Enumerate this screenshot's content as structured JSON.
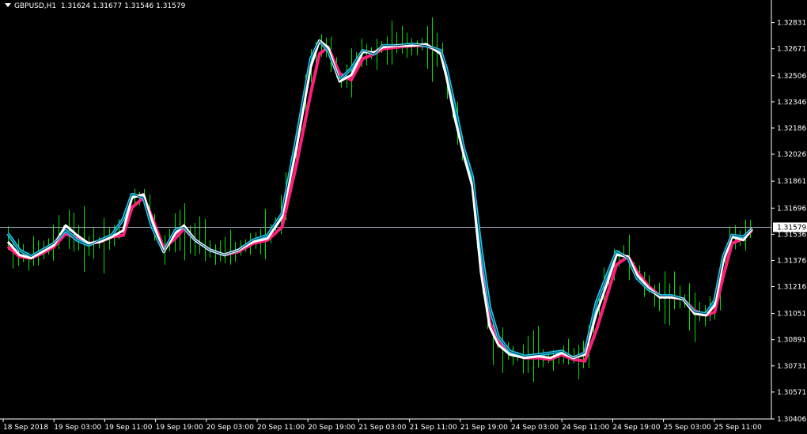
{
  "header": {
    "symbol_tf": "GBPUSD,H1",
    "ohlc": "1.31624 1.31677 1.31546 1.31579"
  },
  "colors": {
    "background": "#000000",
    "candle_wick": "#00e000",
    "ma_fast": "#1ec8f0",
    "ma_mid": "#ffffff",
    "ma_slow": "#ff1f7a",
    "price_line": "#aab4c8",
    "axis": "#ffffff"
  },
  "chart_data": {
    "type": "line",
    "symbol": "GBPUSD",
    "timeframe": "H1",
    "current_price": 1.31579,
    "y_ticks": [
      "1.32831",
      "1.32671",
      "1.32506",
      "1.32346",
      "1.32186",
      "1.32026",
      "1.31861",
      "1.31696",
      "1.31536",
      "1.31376",
      "1.31216",
      "1.31051",
      "1.30891",
      "1.30731",
      "1.30571",
      "1.30406"
    ],
    "x_ticks": [
      "18 Sep 2018",
      "19 Sep 03:00",
      "19 Sep 11:00",
      "19 Sep 19:00",
      "20 Sep 03:00",
      "20 Sep 11:00",
      "20 Sep 19:00",
      "21 Sep 03:00",
      "21 Sep 11:00",
      "21 Sep 19:00",
      "24 Sep 03:00",
      "24 Sep 11:00",
      "24 Sep 19:00",
      "25 Sep 03:00",
      "25 Sep 11:00"
    ],
    "ylim": [
      1.30406,
      1.32921
    ],
    "series": [
      {
        "name": "",
        "color": "#1ec8f0",
        "values": [
          [
            0,
            1.3154
          ],
          [
            0.8,
            1.3144
          ],
          [
            1.6,
            1.314
          ],
          [
            2.4,
            1.3144
          ],
          [
            3.2,
            1.3148
          ],
          [
            4,
            1.3156
          ],
          [
            4.8,
            1.315
          ],
          [
            5.6,
            1.3147
          ],
          [
            6.4,
            1.315
          ],
          [
            7.2,
            1.3153
          ],
          [
            8,
            1.3163
          ],
          [
            8.6,
            1.3178
          ],
          [
            9.4,
            1.3176
          ],
          [
            10,
            1.3158
          ],
          [
            10.8,
            1.3143
          ],
          [
            11.6,
            1.3156
          ],
          [
            12.2,
            1.3158
          ],
          [
            13,
            1.315
          ],
          [
            14,
            1.3144
          ],
          [
            15,
            1.3141
          ],
          [
            16,
            1.3144
          ],
          [
            17,
            1.315
          ],
          [
            18,
            1.3153
          ],
          [
            19,
            1.3166
          ],
          [
            20,
            1.3212
          ],
          [
            21,
            1.3261
          ],
          [
            21.6,
            1.3272
          ],
          [
            22.2,
            1.3266
          ],
          [
            23,
            1.3248
          ],
          [
            23.8,
            1.3255
          ],
          [
            24.6,
            1.3266
          ],
          [
            25.4,
            1.3264
          ],
          [
            26,
            1.3269
          ],
          [
            27,
            1.3269
          ],
          [
            28,
            1.327
          ],
          [
            29,
            1.3269
          ],
          [
            30,
            1.3266
          ],
          [
            30.4,
            1.3255
          ],
          [
            31,
            1.3231
          ],
          [
            31.6,
            1.3206
          ],
          [
            32.2,
            1.3189
          ],
          [
            32.8,
            1.3145
          ],
          [
            33.4,
            1.3109
          ],
          [
            34,
            1.3091
          ],
          [
            34.8,
            1.3082
          ],
          [
            35.8,
            1.3079
          ],
          [
            36.8,
            1.308
          ],
          [
            37.6,
            1.3081
          ],
          [
            38.4,
            1.3082
          ],
          [
            39.2,
            1.3078
          ],
          [
            40,
            1.3081
          ],
          [
            40.8,
            1.3112
          ],
          [
            41.6,
            1.313
          ],
          [
            42.2,
            1.3143
          ],
          [
            43,
            1.3139
          ],
          [
            43.6,
            1.3127
          ],
          [
            44.4,
            1.312
          ],
          [
            45.2,
            1.3116
          ],
          [
            46,
            1.3116
          ],
          [
            46.8,
            1.3114
          ],
          [
            47.6,
            1.3106
          ],
          [
            48.4,
            1.3105
          ],
          [
            49,
            1.3113
          ],
          [
            49.6,
            1.314
          ],
          [
            50.2,
            1.3153
          ],
          [
            51,
            1.3152
          ],
          [
            51.6,
            1.3157
          ]
        ]
      },
      {
        "name": "",
        "color": "#ffffff",
        "values": [
          [
            0,
            1.3149
          ],
          [
            0.8,
            1.3141
          ],
          [
            1.6,
            1.3139
          ],
          [
            2.4,
            1.3143
          ],
          [
            3.2,
            1.3147
          ],
          [
            4,
            1.3159
          ],
          [
            4.8,
            1.3153
          ],
          [
            5.6,
            1.3148
          ],
          [
            6.4,
            1.3149
          ],
          [
            7.2,
            1.3152
          ],
          [
            8,
            1.3156
          ],
          [
            8.6,
            1.3176
          ],
          [
            9.4,
            1.3178
          ],
          [
            10,
            1.3162
          ],
          [
            10.8,
            1.3143
          ],
          [
            11.6,
            1.3154
          ],
          [
            12.2,
            1.3159
          ],
          [
            13,
            1.315
          ],
          [
            14,
            1.3144
          ],
          [
            15,
            1.3141
          ],
          [
            16,
            1.3144
          ],
          [
            17,
            1.3149
          ],
          [
            18,
            1.3151
          ],
          [
            19,
            1.3164
          ],
          [
            20,
            1.3206
          ],
          [
            21,
            1.3256
          ],
          [
            21.6,
            1.3272
          ],
          [
            22.2,
            1.3268
          ],
          [
            23,
            1.3247
          ],
          [
            23.8,
            1.3251
          ],
          [
            24.6,
            1.3265
          ],
          [
            25.4,
            1.3265
          ],
          [
            26,
            1.3268
          ],
          [
            27,
            1.3269
          ],
          [
            28,
            1.3269
          ],
          [
            29,
            1.327
          ],
          [
            30,
            1.3264
          ],
          [
            30.4,
            1.325
          ],
          [
            31,
            1.3224
          ],
          [
            31.6,
            1.3202
          ],
          [
            32.2,
            1.3183
          ],
          [
            32.8,
            1.313
          ],
          [
            33.4,
            1.3097
          ],
          [
            34,
            1.3086
          ],
          [
            34.8,
            1.308
          ],
          [
            35.8,
            1.3078
          ],
          [
            36.8,
            1.3079
          ],
          [
            37.6,
            1.3078
          ],
          [
            38.4,
            1.3081
          ],
          [
            39.2,
            1.3078
          ],
          [
            40,
            1.308
          ],
          [
            40.8,
            1.3105
          ],
          [
            41.6,
            1.3125
          ],
          [
            42.2,
            1.3141
          ],
          [
            43,
            1.314
          ],
          [
            43.6,
            1.3129
          ],
          [
            44.4,
            1.3121
          ],
          [
            45.2,
            1.3115
          ],
          [
            46,
            1.3115
          ],
          [
            46.8,
            1.3114
          ],
          [
            47.6,
            1.3105
          ],
          [
            48.4,
            1.3104
          ],
          [
            49,
            1.311
          ],
          [
            49.6,
            1.3137
          ],
          [
            50.2,
            1.3152
          ],
          [
            51,
            1.315
          ],
          [
            51.6,
            1.3157
          ]
        ]
      },
      {
        "name": "",
        "color": "#ff1f7a",
        "values": [
          [
            0,
            1.3146
          ],
          [
            0.8,
            1.314
          ],
          [
            1.6,
            1.3139
          ],
          [
            2.4,
            1.3142
          ],
          [
            3.2,
            1.3146
          ],
          [
            4,
            1.3154
          ],
          [
            4.8,
            1.3151
          ],
          [
            5.6,
            1.3148
          ],
          [
            6.4,
            1.3149
          ],
          [
            7.2,
            1.3152
          ],
          [
            8,
            1.3153
          ],
          [
            8.6,
            1.317
          ],
          [
            9.4,
            1.3176
          ],
          [
            10,
            1.3164
          ],
          [
            10.8,
            1.3145
          ],
          [
            11.6,
            1.3151
          ],
          [
            12.2,
            1.3157
          ],
          [
            13,
            1.315
          ],
          [
            14,
            1.3144
          ],
          [
            15,
            1.3141
          ],
          [
            16,
            1.3143
          ],
          [
            17,
            1.3148
          ],
          [
            18,
            1.315
          ],
          [
            19,
            1.3158
          ],
          [
            20,
            1.3196
          ],
          [
            21,
            1.324
          ],
          [
            21.6,
            1.3264
          ],
          [
            22.2,
            1.3268
          ],
          [
            23,
            1.3252
          ],
          [
            23.8,
            1.3248
          ],
          [
            24.6,
            1.3261
          ],
          [
            25.4,
            1.3264
          ],
          [
            26,
            1.3267
          ],
          [
            27,
            1.3268
          ],
          [
            28,
            1.3269
          ],
          [
            29,
            1.3269
          ],
          [
            30,
            1.3265
          ],
          [
            30.4,
            1.3253
          ],
          [
            31,
            1.323
          ],
          [
            31.6,
            1.3206
          ],
          [
            32.2,
            1.3188
          ],
          [
            32.8,
            1.314
          ],
          [
            33.4,
            1.31
          ],
          [
            34,
            1.3088
          ],
          [
            34.8,
            1.3081
          ],
          [
            35.8,
            1.3078
          ],
          [
            36.8,
            1.3078
          ],
          [
            37.6,
            1.3077
          ],
          [
            38.4,
            1.308
          ],
          [
            39.2,
            1.3077
          ],
          [
            40,
            1.3076
          ],
          [
            40.8,
            1.3095
          ],
          [
            41.6,
            1.3118
          ],
          [
            42.2,
            1.3135
          ],
          [
            43,
            1.314
          ],
          [
            43.6,
            1.3131
          ],
          [
            44.4,
            1.3122
          ],
          [
            45.2,
            1.3116
          ],
          [
            46,
            1.3115
          ],
          [
            46.8,
            1.3114
          ],
          [
            47.6,
            1.3107
          ],
          [
            48.4,
            1.3104
          ],
          [
            49,
            1.3106
          ],
          [
            49.6,
            1.3128
          ],
          [
            50.2,
            1.3148
          ],
          [
            51,
            1.3151
          ],
          [
            51.6,
            1.3156
          ]
        ]
      }
    ],
    "grid": false
  }
}
